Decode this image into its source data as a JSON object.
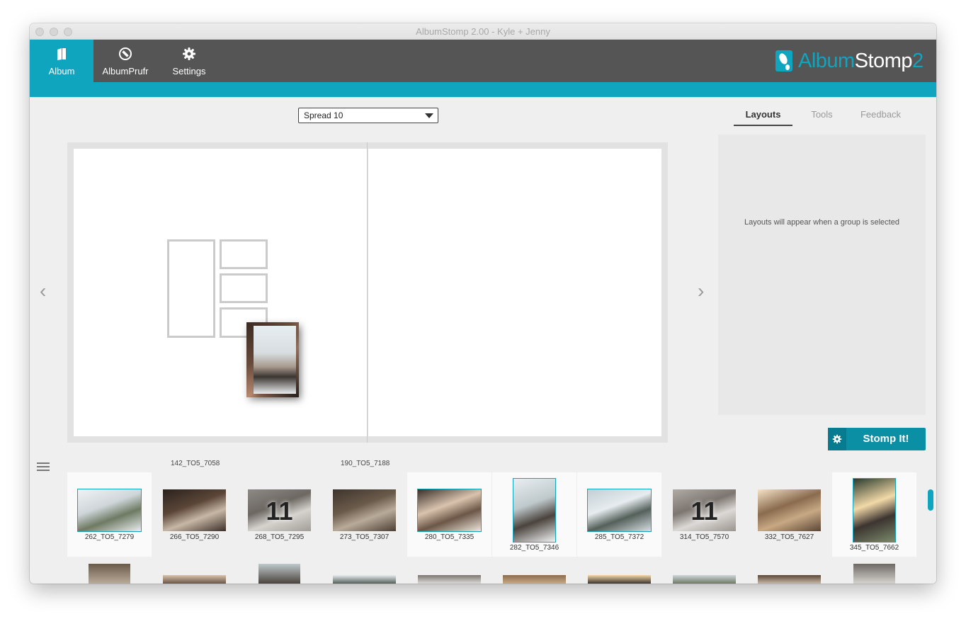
{
  "window": {
    "title": "AlbumStomp 2.00 - Kyle + Jenny"
  },
  "toolbar": {
    "items": [
      {
        "label": "Album",
        "icon": "book-icon",
        "active": true
      },
      {
        "label": "AlbumPrufr",
        "icon": "prufr-icon",
        "active": false
      },
      {
        "label": "Settings",
        "icon": "gear-icon",
        "active": false
      }
    ]
  },
  "logo": {
    "album": "Album",
    "stomp": "Stomp",
    "version": "2"
  },
  "colors": {
    "accent": "#0fa5bf",
    "toolbar_bg": "#555555",
    "stomp_button": "#0b8fa5"
  },
  "spread_select": {
    "value": "Spread 10"
  },
  "right_tabs": [
    {
      "label": "Layouts",
      "active": true
    },
    {
      "label": "Tools",
      "active": false
    },
    {
      "label": "Feedback",
      "active": false
    }
  ],
  "layouts_panel": {
    "empty_message": "Layouts will appear when a group is selected"
  },
  "stomp_button": {
    "label": "Stomp It!"
  },
  "nav": {
    "prev": "‹",
    "next": "›"
  },
  "groups": [
    {
      "label": "142_TO5_7058"
    },
    {
      "label": "190_TO5_7188"
    }
  ],
  "thumbnails": [
    {
      "name": "262_TO5_7279",
      "selected": true,
      "orientation": "landscape",
      "count": ""
    },
    {
      "name": "266_TO5_7290",
      "selected": false,
      "orientation": "landscape",
      "count": ""
    },
    {
      "name": "268_TO5_7295",
      "selected": false,
      "orientation": "landscape",
      "count": "11"
    },
    {
      "name": "273_TO5_7307",
      "selected": false,
      "orientation": "landscape",
      "count": ""
    },
    {
      "name": "280_TO5_7335",
      "selected": true,
      "orientation": "landscape",
      "count": ""
    },
    {
      "name": "282_TO5_7346",
      "selected": true,
      "orientation": "portrait",
      "count": ""
    },
    {
      "name": "285_TO5_7372",
      "selected": true,
      "orientation": "landscape",
      "count": ""
    },
    {
      "name": "314_TO5_7570",
      "selected": false,
      "orientation": "landscape",
      "count": "11"
    },
    {
      "name": "332_TO5_7627",
      "selected": false,
      "orientation": "landscape",
      "count": ""
    },
    {
      "name": "345_TO5_7662",
      "selected": true,
      "orientation": "portrait",
      "count": ""
    }
  ]
}
